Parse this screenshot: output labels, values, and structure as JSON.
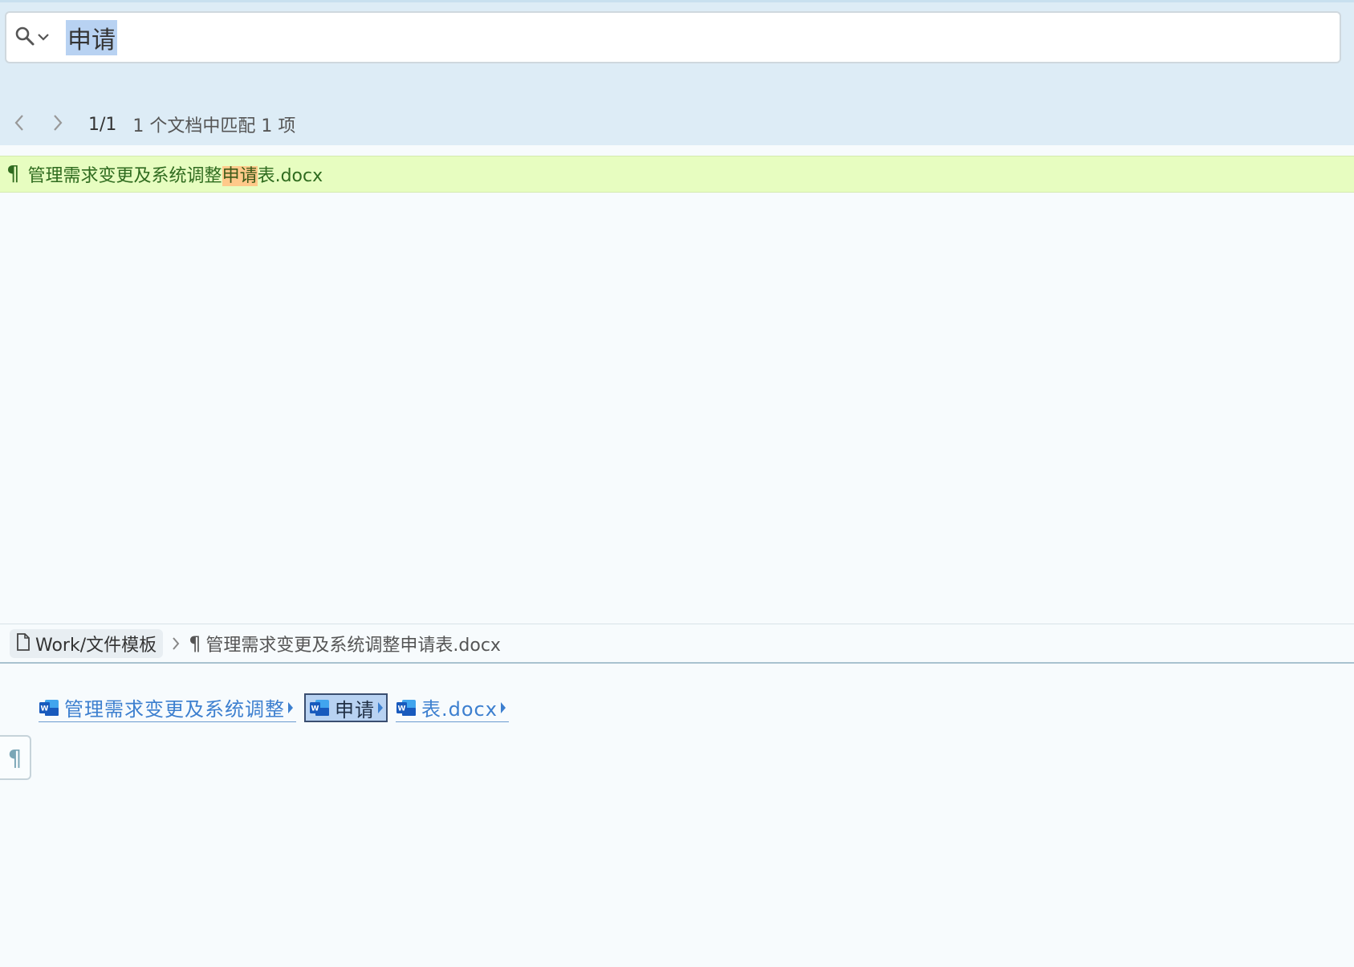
{
  "search": {
    "query": "申请",
    "icon": "search-icon",
    "dropdown_icon": "chevron-down-icon"
  },
  "nav": {
    "prev_icon": "chevron-left-icon",
    "next_icon": "chevron-right-icon",
    "position": "1/1",
    "summary": "1 个文档中匹配 1 项"
  },
  "results": [
    {
      "icon": "pilcrow-icon",
      "text_before": "管理需求变更及系统调整",
      "text_match": "申请",
      "text_after": "表.docx"
    }
  ],
  "breadcrumb": {
    "folder": "Work/文件模板",
    "file": "管理需求变更及系统调整申请表.docx"
  },
  "document": {
    "segments": [
      {
        "text": "管理需求变更及系统调整",
        "active": false
      },
      {
        "text": "申请",
        "active": true
      },
      {
        "text": "表.docx",
        "active": false
      }
    ]
  },
  "colors": {
    "accent": "#3c7fcf",
    "result_bg": "#e7fdc0",
    "match_highlight": "#ffc98a",
    "selection": "#b8d2f2"
  }
}
